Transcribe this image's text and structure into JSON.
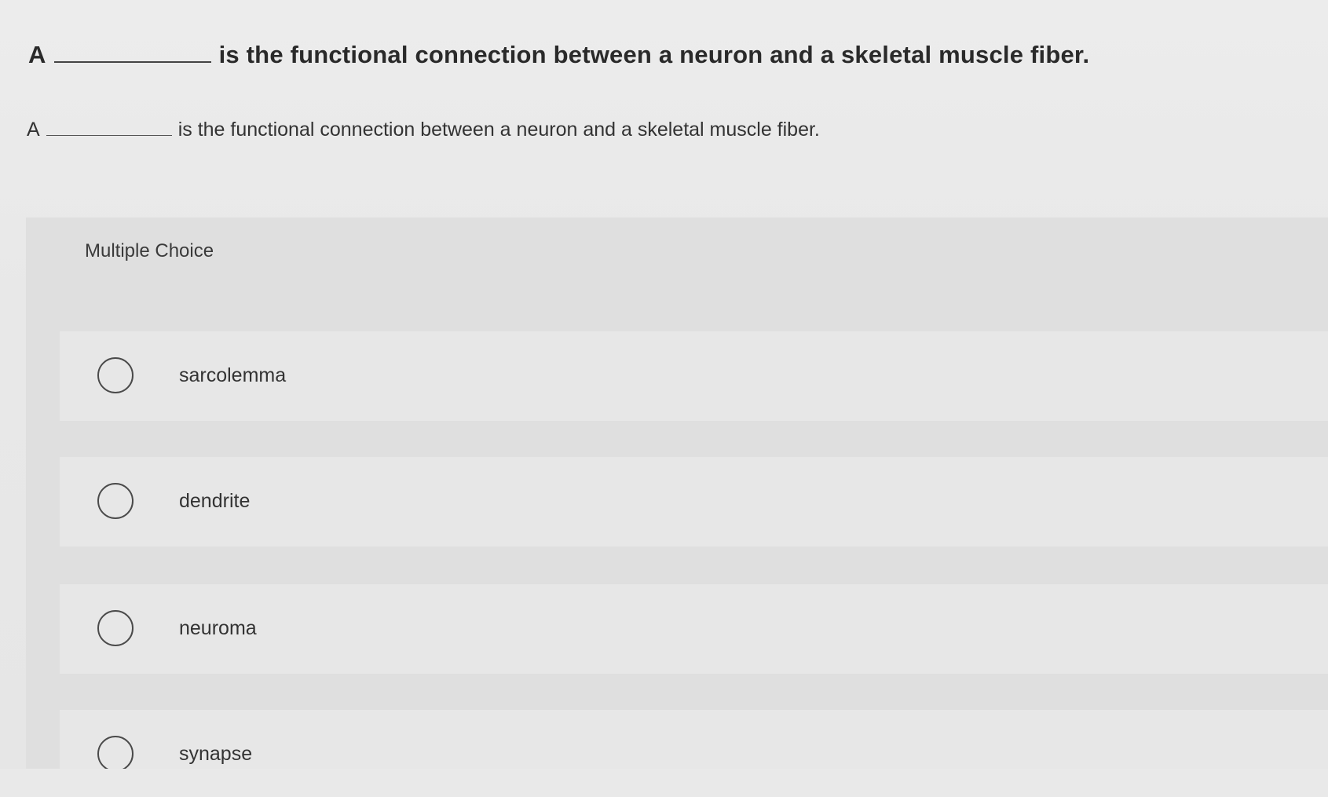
{
  "question": {
    "title_prefix": "A",
    "title_suffix": "is the functional connection between a neuron and a skeletal muscle fiber.",
    "prompt_prefix": "A",
    "prompt_suffix": "is the functional connection between a neuron and a skeletal muscle fiber."
  },
  "multiple_choice": {
    "header": "Multiple Choice",
    "options": [
      {
        "label": "sarcolemma",
        "selected": false
      },
      {
        "label": "dendrite",
        "selected": false
      },
      {
        "label": "neuroma",
        "selected": false
      },
      {
        "label": "synapse",
        "selected": false
      }
    ]
  }
}
